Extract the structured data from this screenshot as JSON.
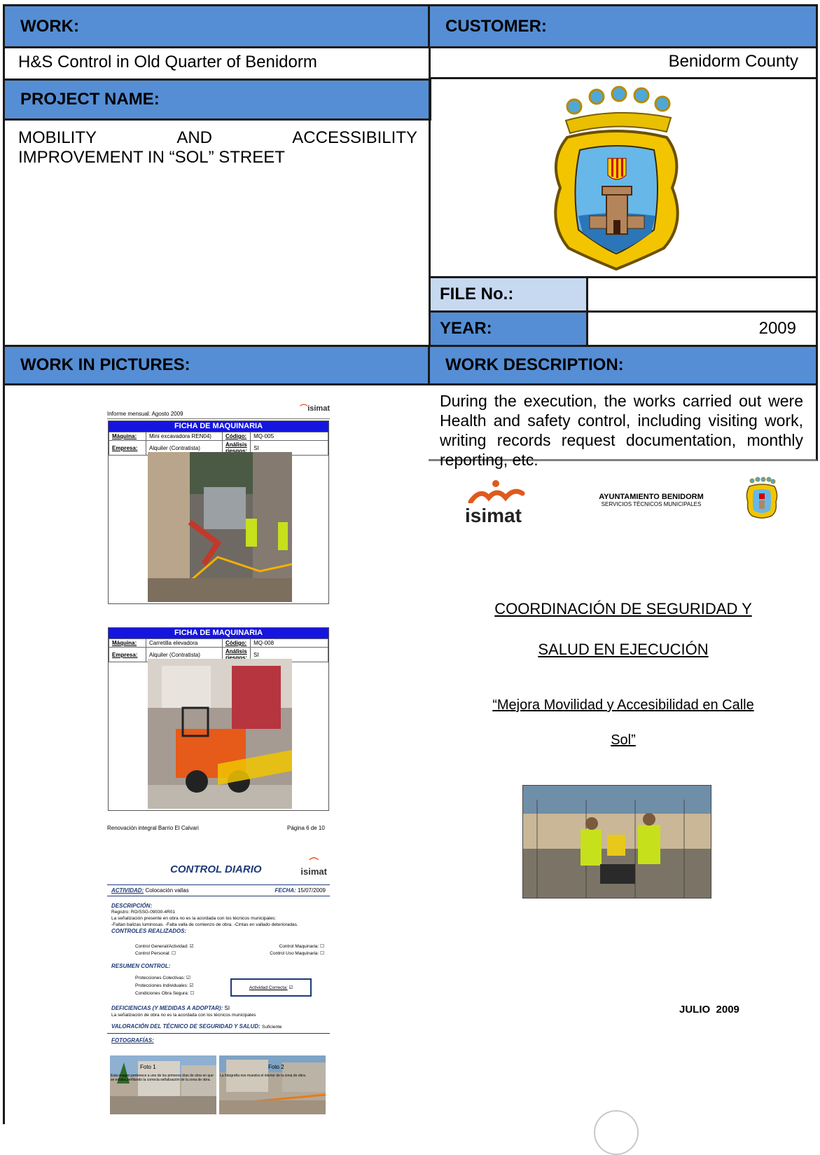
{
  "headers": {
    "work": "WORK:",
    "customer": "CUSTOMER:",
    "project_name": "PROJECT NAME:",
    "file_no": "FILE No.:",
    "year": "YEAR:",
    "work_in_pictures": "WORK IN PICTURES:",
    "work_description": "WORK DESCRIPTION:"
  },
  "values": {
    "work": "H&S Control in Old Quarter of Benidorm",
    "customer": "Benidorm County",
    "project_line1": "MOBILITY AND ACCESSIBILITY",
    "project_line2": "IMPROVEMENT IN “SOL” STREET",
    "file_no": "",
    "year": "2009",
    "description": "During the execution, the works carried out were Health and safety control, including visiting work, writing records request documentation, monthly reporting, etc."
  },
  "cover": {
    "logo_text": "isimat",
    "org_line1": "AYUNTAMIENTO BENIDORM",
    "org_line2": "SERVICIOS TÉCNICOS MUNICIPALES",
    "title_line1": "COORDINACIÓN DE SEGURIDAD Y",
    "title_line2": "SALUD EN EJECUCIÓN",
    "subtitle_line1": "“Mejora Movilidad y Accesibilidad en Calle",
    "subtitle_line2": "Sol”",
    "date": "JULIO  2009"
  },
  "pictures": {
    "page1_header": "Informe mensual: Agosto 2009",
    "card1": {
      "title": "FICHA DE MAQUINARIA",
      "maquina_label": "Máquina:",
      "maquina": "Mini excavadora REN04)",
      "codigo_label": "Código:",
      "codigo": "MQ-005",
      "empresa_label": "Empresa:",
      "empresa": "Alquiler (Contratista)",
      "analisis_label": "Análisis riesgos:",
      "analisis": "SI"
    },
    "card2": {
      "title": "FICHA DE MAQUINARIA",
      "maquina_label": "Máquina:",
      "maquina": "Carretilla elevadora",
      "codigo_label": "Código:",
      "codigo": "MQ-008",
      "empresa_label": "Empresa:",
      "empresa": "Alquiler (Contratista)",
      "analisis_label": "Análisis riesgos:",
      "analisis": "SI"
    },
    "page1_footer_left": "Renovación integral Barrio El Calvari",
    "page1_footer_right": "Página 6 de 10",
    "control": {
      "title": "CONTROL DIARIO",
      "actividad_label": "ACTIVIDAD:",
      "actividad": "Colocación vallas",
      "fecha_label": "FECHA:",
      "fecha": "15/07/2009",
      "descripcion_label": "DESCRIPCIÓN:",
      "descripcion_1": "Registro: RO/SSG-09030-4R01",
      "descripcion_2": "La señalización presente en obra no es la acordada con los técnicos municipales:",
      "descripcion_3": "-Faltan balizas luminosas. -Falta valla de comienzo de obra. -Cintas en vallado deterioradas.",
      "controles_label": "CONTROLES REALIZADOS:",
      "c1": "Control General/Actividad:",
      "c2": "Control Maquinaria:",
      "c3": "Control Personal:",
      "c4": "Control Uso Maquinaria:",
      "resumen_label": "RESUMEN CONTROL:",
      "r1": "Protecciones Colectivas:",
      "r2": "Protecciones Individuales:",
      "r3": "Condiciones Obra Segura:",
      "correcta": "Actividad Correcta:",
      "deficiencias_label": "DEFICIENCIAS (Y MEDIDAS A ADOPTAR):",
      "deficiencias": "SI",
      "deficiencias_text": "La señalización de obra no es la acordada con los técnicos municipales",
      "valoracion_label": "VALORACIÓN DEL TÉCNICO DE SEGURIDAD Y SALUD:",
      "valoracion": "Suficiente",
      "fotos_label": "FOTOGRAFÍAS:",
      "foto1": "Foto 1",
      "foto2": "Foto 2",
      "foto1_text": "Esta imagen pertenece a uno de los primeros días de obra en que se estaba perfilando la correcta señalización de la zona de obra.",
      "foto2_text": "La fotografía nos muestra el interior de la zona de obra."
    }
  }
}
